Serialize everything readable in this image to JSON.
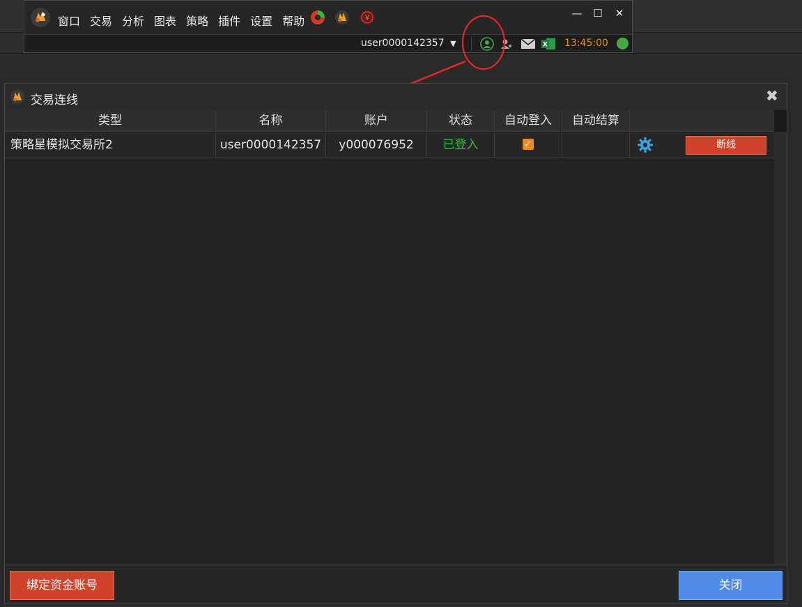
{
  "app": {
    "menu": [
      "窗口",
      "交易",
      "分析",
      "图表",
      "策略",
      "插件",
      "设置",
      "帮助"
    ],
    "window_controls": {
      "minimize": "—",
      "maximize": "☐",
      "close": "✕"
    },
    "statusbar": {
      "user": "user0000142357",
      "time": "13:45:00"
    },
    "icons": [
      "account-icon",
      "users-icon",
      "mail-icon",
      "excel-icon"
    ]
  },
  "dialog": {
    "title": "交易连线",
    "close": "✖",
    "columns": [
      "类型",
      "名称",
      "账户",
      "状态",
      "自动登入",
      "自动结算"
    ],
    "rows": [
      {
        "type": "策略星模拟交易所2",
        "name": "user0000142357",
        "account": "y000076952",
        "status": "已登入",
        "auto_login": true,
        "auto_settle": false,
        "action": "断线"
      }
    ],
    "bind_button": "绑定资金账号",
    "close_button": "关闭"
  },
  "colors": {
    "accent_red": "#d0432a",
    "accent_blue": "#4f8ae8",
    "status_green": "#2fbf3a",
    "clock_orange": "#e08a2a"
  }
}
